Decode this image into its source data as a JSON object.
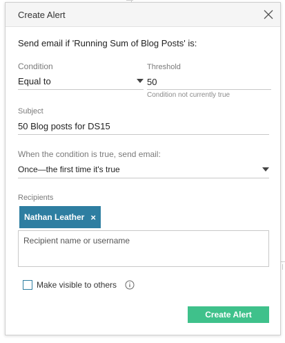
{
  "dialog": {
    "title": "Create Alert",
    "headline": "Send email if 'Running Sum of Blog Posts' is:"
  },
  "condition": {
    "label": "Condition",
    "value": "Equal to"
  },
  "threshold": {
    "label": "Threshold",
    "value": "50",
    "note": "Condition not currently true"
  },
  "subject": {
    "label": "Subject",
    "value": "50 Blog posts for DS15"
  },
  "frequency": {
    "label": "When the condition is true, send email:",
    "value": "Once—the first time it's true"
  },
  "recipients": {
    "label": "Recipients",
    "chips": [
      {
        "name": "Nathan Leather",
        "remove": "×"
      }
    ],
    "placeholder": "Recipient name or username"
  },
  "visibility": {
    "label": "Make visible to others",
    "checked": false
  },
  "actions": {
    "create_label": "Create Alert"
  },
  "colors": {
    "accent": "#2e7ea1",
    "primary_button": "#3fc18b"
  },
  "icons": {
    "close": "close-icon",
    "dropdown": "chevron-down-icon",
    "info": "info-icon"
  }
}
